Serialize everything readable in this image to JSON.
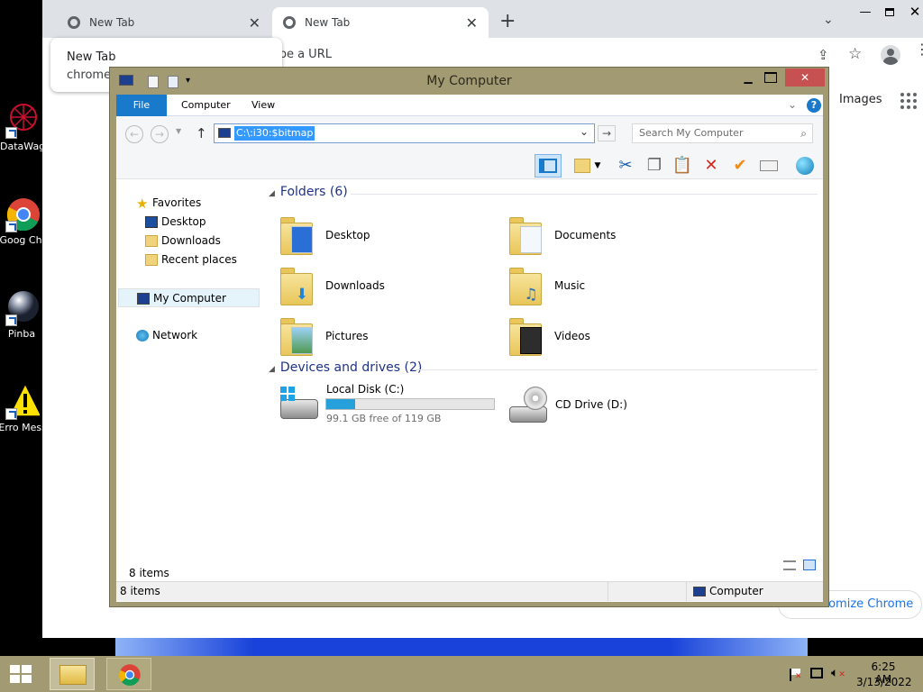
{
  "desktop": {
    "icons": [
      {
        "label": "DataWag",
        "icon": "datawag-icon"
      },
      {
        "label": "Goog Chron",
        "icon": "chrome-icon"
      },
      {
        "label": "Pinba",
        "icon": "pinball-icon"
      },
      {
        "label": "Erro Messag",
        "icon": "warning-icon"
      }
    ]
  },
  "chrome": {
    "tabs": [
      {
        "title": "New Tab"
      },
      {
        "title": "New Tab"
      }
    ],
    "tooltip": {
      "title": "New Tab",
      "url": "chrome:/"
    },
    "omnibox_placeholder": "ype a URL",
    "ntp": {
      "images_link": "Images",
      "customize": "tomize Chrome"
    }
  },
  "explorer": {
    "title": "My Computer",
    "ribbon_tabs": [
      "File",
      "Computer",
      "View"
    ],
    "address": "C:\\:i30:$bitmap",
    "search_placeholder": "Search My Computer",
    "nav": {
      "favorites": "Favorites",
      "fav_items": [
        "Desktop",
        "Downloads",
        "Recent places"
      ],
      "my_computer": "My Computer",
      "network": "Network"
    },
    "folders_header": "Folders (6)",
    "folders": [
      "Desktop",
      "Documents",
      "Downloads",
      "Music",
      "Pictures",
      "Videos"
    ],
    "devices_header": "Devices and drives (2)",
    "drives": [
      {
        "name": "Local Disk (C:)",
        "free": "99.1 GB free of 119 GB",
        "used_fraction": 0.17
      },
      {
        "name": "CD Drive (D:)"
      }
    ],
    "items_count": "8 items",
    "status_left": "8 items",
    "status_right": "Computer"
  },
  "taskbar": {
    "time": "6:25 AM",
    "date": "3/13/2022"
  },
  "colors": {
    "accent": "#1979ca",
    "title_bar": "#a19a73",
    "close": "#c75050"
  }
}
